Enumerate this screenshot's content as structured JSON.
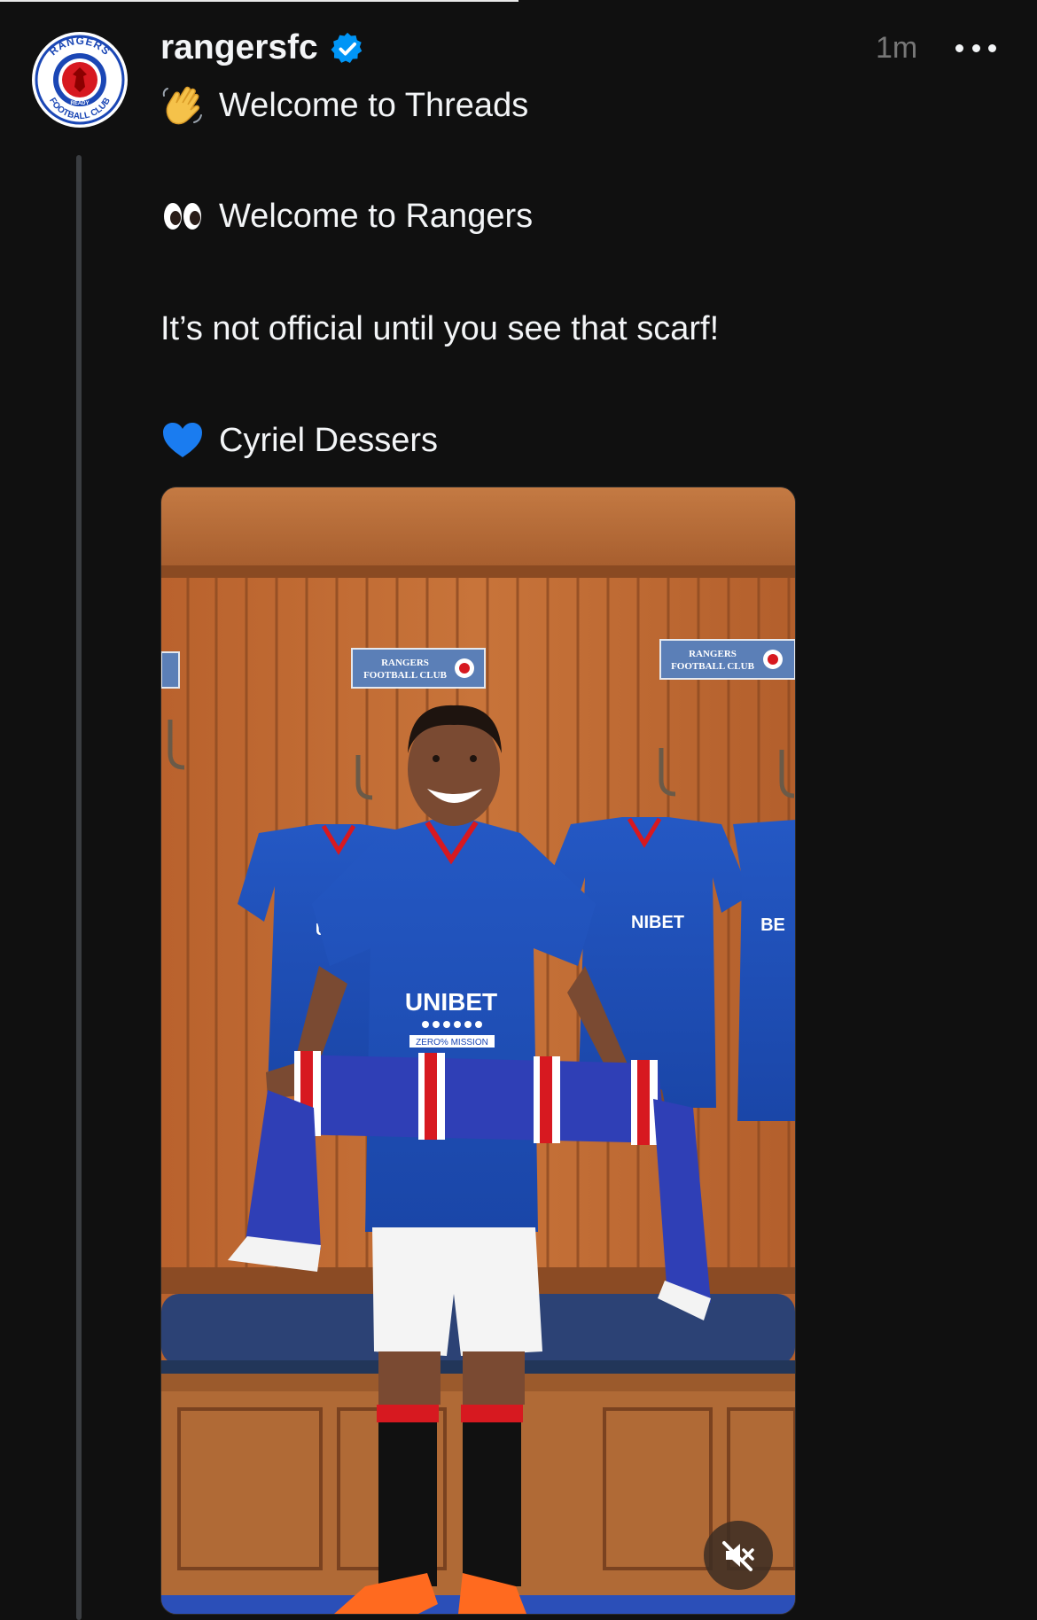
{
  "post": {
    "username": "rangersfc",
    "verified": true,
    "time": "1m",
    "lines": [
      {
        "emoji": "waving-hand-icon",
        "text": "Welcome to Threads"
      },
      {
        "emoji": "eyes-icon",
        "text": "Welcome to Rangers"
      },
      {
        "emoji": "",
        "text": "It’s not official until you see that scarf!"
      },
      {
        "emoji": "blue-heart-icon",
        "text": "Cyriel Dessers"
      }
    ]
  },
  "avatar": {
    "logo_text_top": "RANGERS",
    "logo_text_bottom": "FOOTBALL CLUB",
    "logo_motto": "READY"
  },
  "media": {
    "type": "video",
    "signs": [
      "RANGERS",
      "FOOTBALL CLUB"
    ],
    "shirt_sponsor": "UNIBET",
    "shirt_sub": "ZERO% MISSION",
    "muted": true
  },
  "colors": {
    "background": "#101010",
    "text": "#f3f5f7",
    "muted_text": "#777777",
    "verified": "#0095f6",
    "rangers_blue": "#1b47b5",
    "rangers_red": "#d71920"
  }
}
